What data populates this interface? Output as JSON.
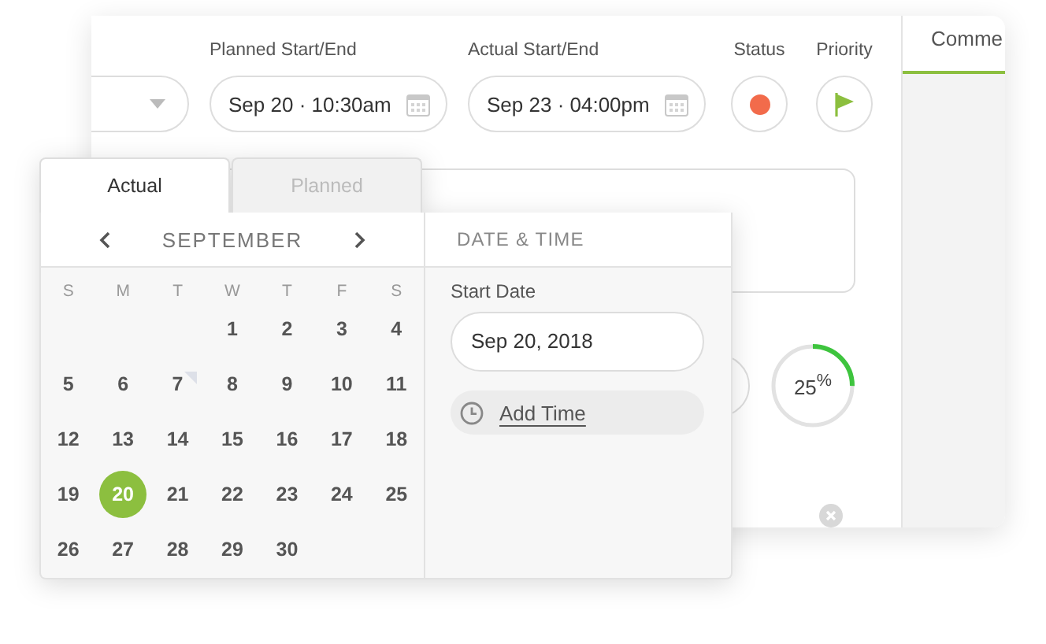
{
  "fields": [
    {
      "label": "Planned Start/End",
      "value": "Sep 20 · 10:30am"
    },
    {
      "label": "Actual Start/End",
      "value": "Sep 23 · 04:00pm"
    }
  ],
  "status": {
    "label": "Status"
  },
  "priority": {
    "label": "Priority"
  },
  "side_tabs": [
    {
      "label": "Comme",
      "selected": true
    }
  ],
  "progress": {
    "level": 0.25,
    "reading": "25$^{%}$"
  },
  "date_popup": {
    "tabs": [
      {
        "label": "Actual",
        "selected": true
      },
      {
        "label": "Planned",
        "selected": false
      }
    ],
    "month": "SEPTEMBER",
    "weekdays": [
      "S",
      "M",
      "T",
      "W",
      "T",
      "F",
      "S"
    ],
    "weeks": [
      [
        {
          "day": "1",
          "selected": false,
          "marked": false
        },
        {
          "day": "2",
          "selected": false,
          "marked": false
        },
        {
          "day": "3",
          "selected": false,
          "marked": false
        },
        {
          "day": "4",
          "selected": false,
          "marked": false
        }
      ],
      [
        {
          "day": "5",
          "selected": false,
          "marked": false
        },
        {
          "day": "6",
          "selected": false,
          "marked": false
        },
        {
          "day": "7",
          "selected": false,
          "marked": true
        },
        {
          "day": "8",
          "selected": false,
          "marked": false
        },
        {
          "day": "9",
          "selected": false,
          "marked": false
        },
        {
          "day": "10",
          "selected": false,
          "marked": false
        },
        {
          "day": "11",
          "selected": false,
          "marked": false
        }
      ],
      [
        {
          "day": "12",
          "selected": false,
          "marked": false
        },
        {
          "day": "13",
          "selected": false,
          "marked": false
        },
        {
          "day": "14",
          "selected": false,
          "marked": false
        },
        {
          "day": "15",
          "selected": false,
          "marked": false
        },
        {
          "day": "16",
          "selected": false,
          "marked": false
        },
        {
          "day": "17",
          "selected": false,
          "marked": false
        },
        {
          "day": "18",
          "selected": false,
          "marked": false
        }
      ],
      [
        {
          "day": "19",
          "selected": false,
          "marked": false
        },
        {
          "day": "20",
          "selected": true,
          "marked": false
        },
        {
          "day": "21",
          "selected": false,
          "marked": false
        },
        {
          "day": "22",
          "selected": false,
          "marked": false
        },
        {
          "day": "23",
          "selected": false,
          "marked": false
        },
        {
          "day": "24",
          "selected": false,
          "marked": false
        },
        {
          "day": "25",
          "selected": false,
          "marked": false
        }
      ],
      [
        {
          "day": "26",
          "selected": false,
          "marked": false
        },
        {
          "day": "27",
          "selected": false,
          "marked": false
        },
        {
          "day": "28",
          "selected": false,
          "marked": false
        },
        {
          "day": "29",
          "selected": false,
          "marked": false
        },
        {
          "day": "30",
          "selected": false,
          "marked": false
        }
      ]
    ],
    "panel_title": "DATE & TIME",
    "start_label": "Start Date",
    "start_value": "Sep 20, 2018",
    "add_time": "Add Time"
  }
}
